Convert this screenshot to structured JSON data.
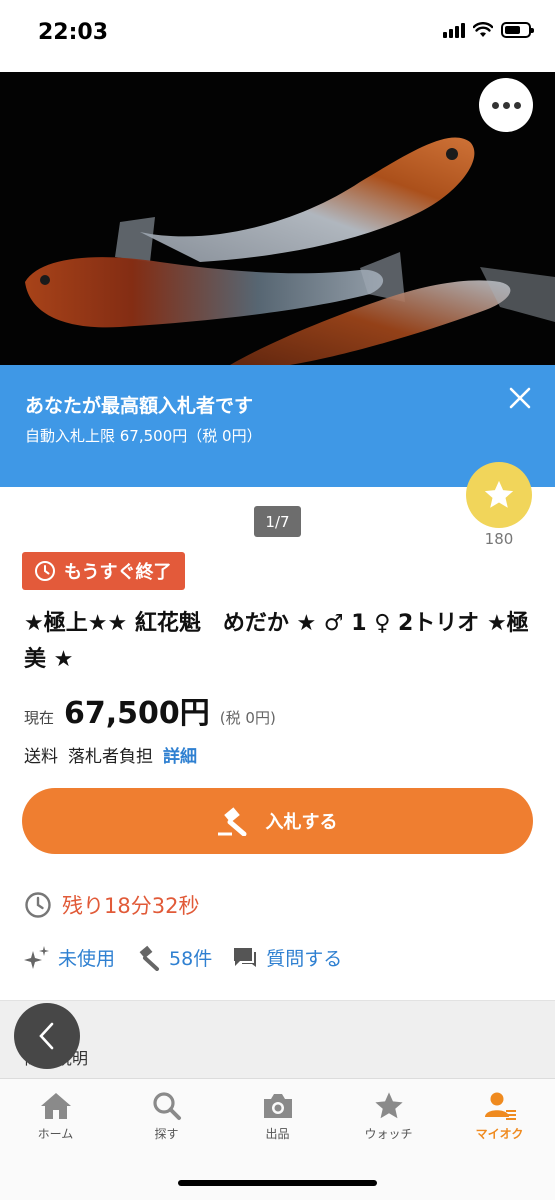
{
  "status_bar": {
    "time": "22:03"
  },
  "hero": {
    "image_alt": "red and orange medaka fish on black background"
  },
  "banner": {
    "title": "あなたが最高額入札者です",
    "subtitle": "自動入札上限 67,500円（税 0円）"
  },
  "gallery": {
    "pager": "1/7"
  },
  "watch": {
    "count": "180"
  },
  "item": {
    "ending_badge": "もうすぐ終了",
    "title": "★極上★★ 紅花魁　めだか ★ ♂ 1 ♀ 2トリオ ★極美 ★",
    "price_label": "現在",
    "price": "67,500円",
    "price_tax": "(税 0円)",
    "shipping_label": "送料",
    "shipping_value": "落札者負担",
    "shipping_detail": "詳細",
    "bid_button": "入札する",
    "remaining": "残り18分32秒",
    "condition": "未使用",
    "bids": "58件",
    "question": "質問する"
  },
  "section": {
    "label": "商品説明"
  },
  "tab_bar": {
    "items": [
      {
        "label": "ホーム",
        "icon": "home-icon"
      },
      {
        "label": "探す",
        "icon": "search-icon"
      },
      {
        "label": "出品",
        "icon": "camera-icon"
      },
      {
        "label": "ウォッチ",
        "icon": "star-icon"
      },
      {
        "label": "マイオク",
        "icon": "user-icon"
      }
    ],
    "active": "マイオク"
  },
  "colors": {
    "accent_orange": "#ef7e30",
    "banner_blue": "#3f98e6",
    "badge_red": "#e35a3a",
    "link_blue": "#2f80d1",
    "watch_yellow": "#f1d55a"
  }
}
